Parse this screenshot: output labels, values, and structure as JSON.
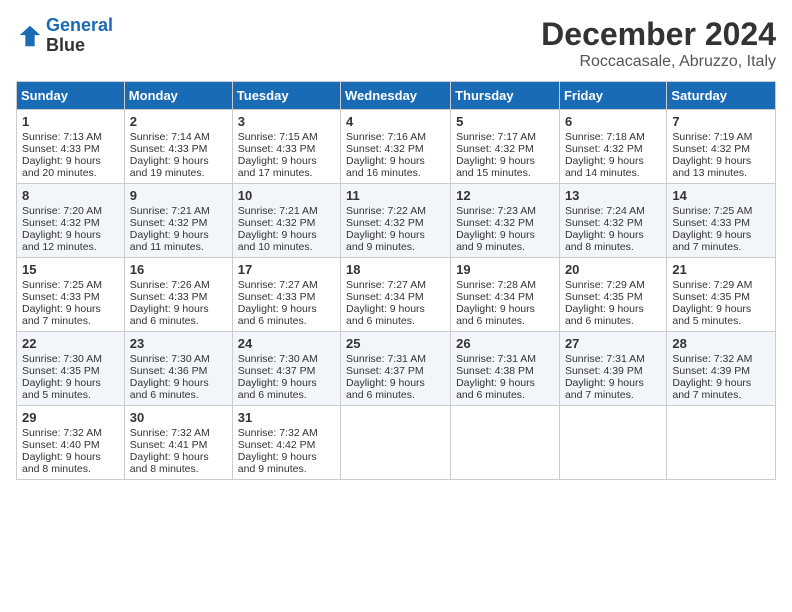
{
  "header": {
    "logo_line1": "General",
    "logo_line2": "Blue",
    "month": "December 2024",
    "location": "Roccacasale, Abruzzo, Italy"
  },
  "weekdays": [
    "Sunday",
    "Monday",
    "Tuesday",
    "Wednesday",
    "Thursday",
    "Friday",
    "Saturday"
  ],
  "weeks": [
    [
      {
        "day": "1",
        "sunrise": "7:13 AM",
        "sunset": "4:33 PM",
        "daylight": "9 hours and 20 minutes."
      },
      {
        "day": "2",
        "sunrise": "7:14 AM",
        "sunset": "4:33 PM",
        "daylight": "9 hours and 19 minutes."
      },
      {
        "day": "3",
        "sunrise": "7:15 AM",
        "sunset": "4:33 PM",
        "daylight": "9 hours and 17 minutes."
      },
      {
        "day": "4",
        "sunrise": "7:16 AM",
        "sunset": "4:32 PM",
        "daylight": "9 hours and 16 minutes."
      },
      {
        "day": "5",
        "sunrise": "7:17 AM",
        "sunset": "4:32 PM",
        "daylight": "9 hours and 15 minutes."
      },
      {
        "day": "6",
        "sunrise": "7:18 AM",
        "sunset": "4:32 PM",
        "daylight": "9 hours and 14 minutes."
      },
      {
        "day": "7",
        "sunrise": "7:19 AM",
        "sunset": "4:32 PM",
        "daylight": "9 hours and 13 minutes."
      }
    ],
    [
      {
        "day": "8",
        "sunrise": "7:20 AM",
        "sunset": "4:32 PM",
        "daylight": "9 hours and 12 minutes."
      },
      {
        "day": "9",
        "sunrise": "7:21 AM",
        "sunset": "4:32 PM",
        "daylight": "9 hours and 11 minutes."
      },
      {
        "day": "10",
        "sunrise": "7:21 AM",
        "sunset": "4:32 PM",
        "daylight": "9 hours and 10 minutes."
      },
      {
        "day": "11",
        "sunrise": "7:22 AM",
        "sunset": "4:32 PM",
        "daylight": "9 hours and 9 minutes."
      },
      {
        "day": "12",
        "sunrise": "7:23 AM",
        "sunset": "4:32 PM",
        "daylight": "9 hours and 9 minutes."
      },
      {
        "day": "13",
        "sunrise": "7:24 AM",
        "sunset": "4:32 PM",
        "daylight": "9 hours and 8 minutes."
      },
      {
        "day": "14",
        "sunrise": "7:25 AM",
        "sunset": "4:33 PM",
        "daylight": "9 hours and 7 minutes."
      }
    ],
    [
      {
        "day": "15",
        "sunrise": "7:25 AM",
        "sunset": "4:33 PM",
        "daylight": "9 hours and 7 minutes."
      },
      {
        "day": "16",
        "sunrise": "7:26 AM",
        "sunset": "4:33 PM",
        "daylight": "9 hours and 6 minutes."
      },
      {
        "day": "17",
        "sunrise": "7:27 AM",
        "sunset": "4:33 PM",
        "daylight": "9 hours and 6 minutes."
      },
      {
        "day": "18",
        "sunrise": "7:27 AM",
        "sunset": "4:34 PM",
        "daylight": "9 hours and 6 minutes."
      },
      {
        "day": "19",
        "sunrise": "7:28 AM",
        "sunset": "4:34 PM",
        "daylight": "9 hours and 6 minutes."
      },
      {
        "day": "20",
        "sunrise": "7:29 AM",
        "sunset": "4:35 PM",
        "daylight": "9 hours and 6 minutes."
      },
      {
        "day": "21",
        "sunrise": "7:29 AM",
        "sunset": "4:35 PM",
        "daylight": "9 hours and 5 minutes."
      }
    ],
    [
      {
        "day": "22",
        "sunrise": "7:30 AM",
        "sunset": "4:35 PM",
        "daylight": "9 hours and 5 minutes."
      },
      {
        "day": "23",
        "sunrise": "7:30 AM",
        "sunset": "4:36 PM",
        "daylight": "9 hours and 6 minutes."
      },
      {
        "day": "24",
        "sunrise": "7:30 AM",
        "sunset": "4:37 PM",
        "daylight": "9 hours and 6 minutes."
      },
      {
        "day": "25",
        "sunrise": "7:31 AM",
        "sunset": "4:37 PM",
        "daylight": "9 hours and 6 minutes."
      },
      {
        "day": "26",
        "sunrise": "7:31 AM",
        "sunset": "4:38 PM",
        "daylight": "9 hours and 6 minutes."
      },
      {
        "day": "27",
        "sunrise": "7:31 AM",
        "sunset": "4:39 PM",
        "daylight": "9 hours and 7 minutes."
      },
      {
        "day": "28",
        "sunrise": "7:32 AM",
        "sunset": "4:39 PM",
        "daylight": "9 hours and 7 minutes."
      }
    ],
    [
      {
        "day": "29",
        "sunrise": "7:32 AM",
        "sunset": "4:40 PM",
        "daylight": "9 hours and 8 minutes."
      },
      {
        "day": "30",
        "sunrise": "7:32 AM",
        "sunset": "4:41 PM",
        "daylight": "9 hours and 8 minutes."
      },
      {
        "day": "31",
        "sunrise": "7:32 AM",
        "sunset": "4:42 PM",
        "daylight": "9 hours and 9 minutes."
      },
      null,
      null,
      null,
      null
    ]
  ]
}
